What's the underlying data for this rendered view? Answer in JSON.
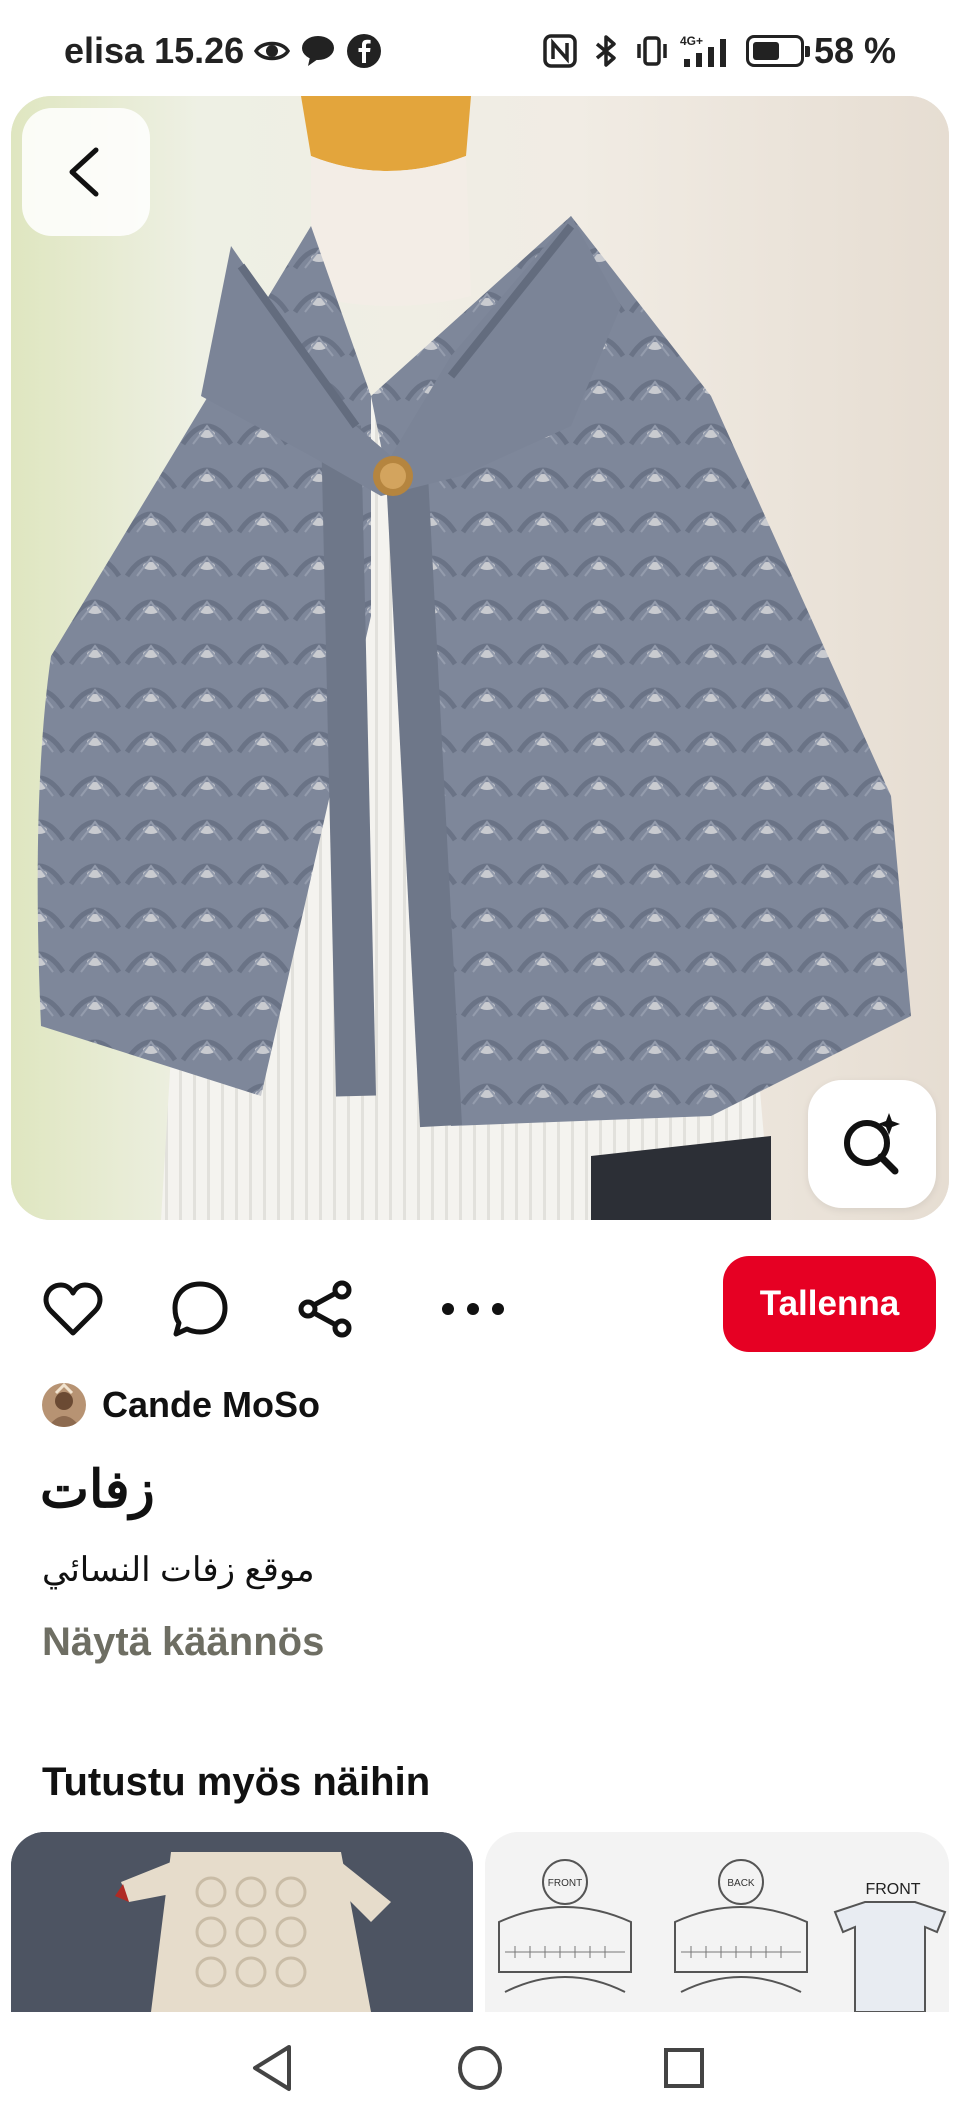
{
  "status_bar": {
    "carrier_time": "elisa 15.26",
    "battery_text": "58 %",
    "battery_level": 0.58,
    "icons_left": [
      "eye-icon",
      "chat-bubble-icon",
      "facebook-icon"
    ],
    "icons_right": [
      "nfc-icon",
      "bluetooth-icon",
      "vibrate-icon",
      "signal-4g-icon",
      "battery-icon"
    ]
  },
  "pin": {
    "author": "Cande MoSo",
    "title": "زفات",
    "description": "موقع زفات النسائي",
    "translate_label": "Näytä käännös",
    "save_label": "Tallenna"
  },
  "actions": [
    "heart-icon",
    "comment-icon",
    "share-icon",
    "more-icon"
  ],
  "related": {
    "title": "Tutustu myös näihin",
    "card2_labels": {
      "front": "FRONT",
      "back": "BACK",
      "front_big": "FRONT"
    }
  },
  "colors": {
    "accent": "#e60023",
    "translate": "#6e6e63",
    "cape": "#7d8596"
  }
}
